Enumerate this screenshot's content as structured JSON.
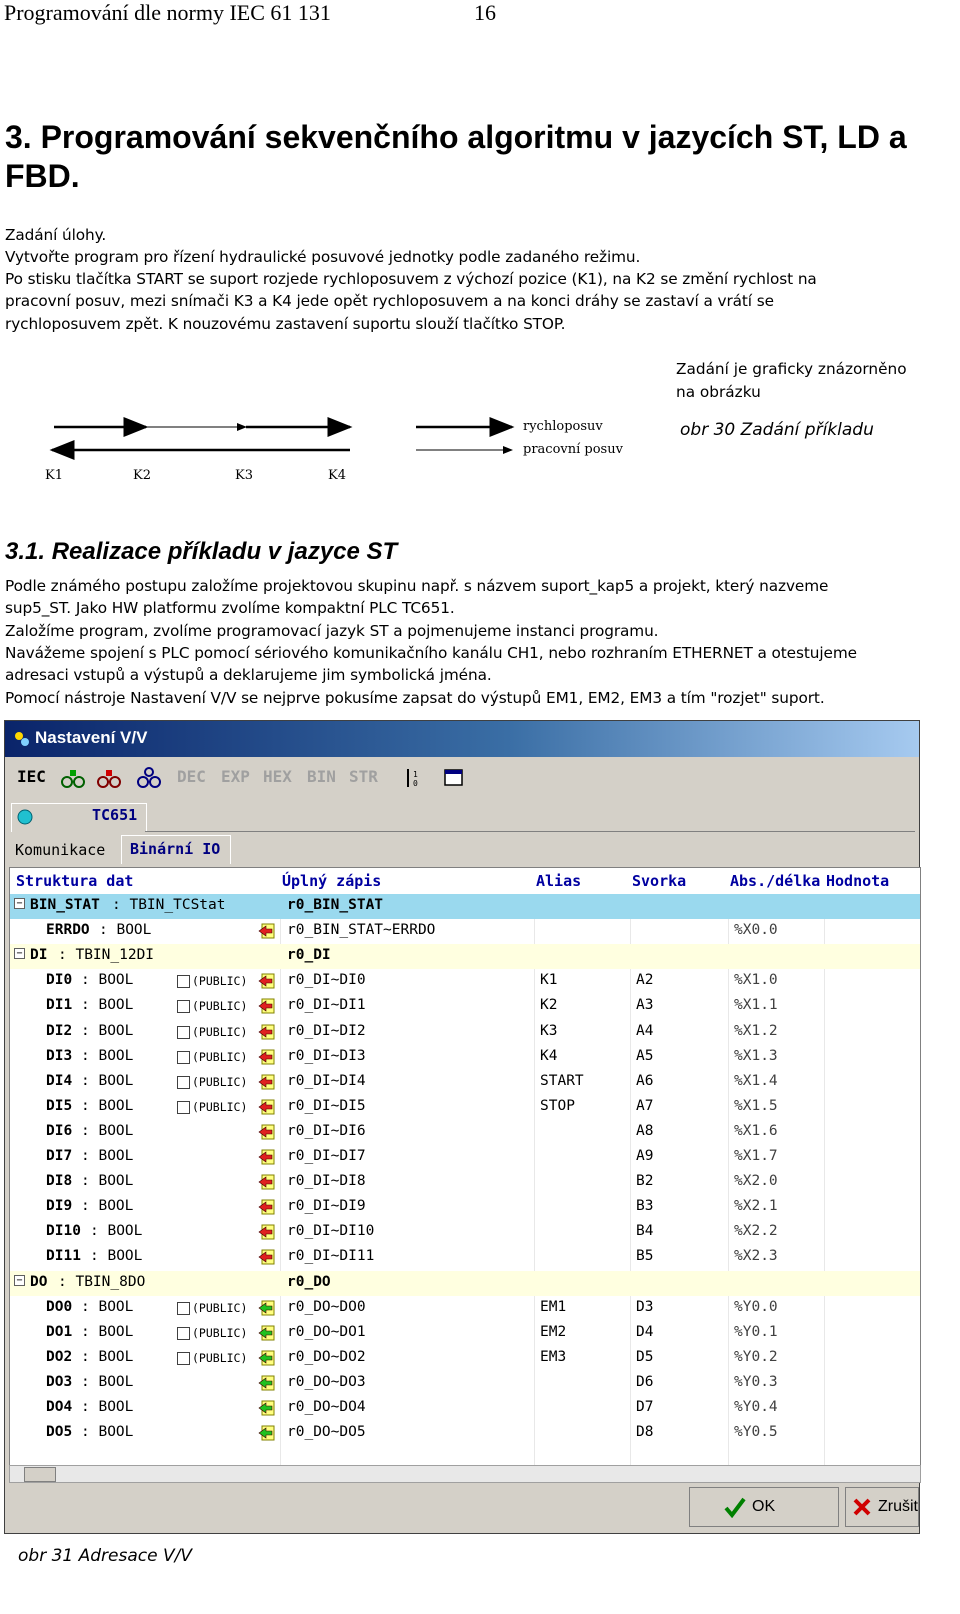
{
  "header": {
    "title": "Programování dle normy IEC 61 131",
    "page": "16"
  },
  "chapter_title": "3. Programování sekvenčního algoritmu v jazycích ST, LD a FBD.",
  "task": {
    "heading": "Zadání úlohy.",
    "lines": [
      "Vytvořte program pro řízení hydraulické posuvové jednotky podle zadaného režimu.",
      "Po stisku tlačítka START se suport rozjede rychloposuvem z výchozí pozice (K1), na K2 se změní rychlost na",
      "pracovní posuv, mezi snímači K3 a K4 jede opět rychloposuvem a na konci dráhy se zastaví a vrátí se",
      "rychloposuvem zpět. K nouzovému zastavení suportu slouží tlačítko STOP."
    ]
  },
  "figure30": {
    "note_lines": [
      "Zadání je graficky znázorněno",
      "na obrázku"
    ],
    "caption": "obr 30 Zadání příkladu",
    "positions": [
      "K1",
      "K2",
      "K3",
      "K4"
    ],
    "legend": [
      "rychloposuv",
      "pracovní posuv"
    ]
  },
  "section": "3.1. Realizace příkladu v jazyce ST",
  "paragraphs": [
    "Podle známého postupu založíme projektovou skupinu např. s názvem suport_kap5 a projekt, který nazveme",
    "sup5_ST. Jako HW platformu zvolíme kompaktní PLC TC651.",
    "Založíme program, zvolíme programovací jazyk ST a pojmenujeme instanci programu.",
    "Navážeme spojení s PLC pomocí sériového komunikačního kanálu CH1, nebo rozhraním ETHERNET a otestujeme",
    "adresaci vstupů a výstupů a deklarujeme jim symbolická jména.",
    "Pomocí nástroje Nastavení V/V se nejprve pokusíme zapsat do výstupů EM1, EM2, EM3 a tím \"rozjet\" suport."
  ],
  "window": {
    "title": "Nastavení V/V",
    "toolbar": [
      "IEC",
      "DEC",
      "EXP",
      "HEX",
      "BIN",
      "STR"
    ],
    "plc_tab": "TC651",
    "tabs": [
      "Komunikace",
      "Binární IO"
    ],
    "columns": [
      "Struktura dat",
      "Úplný zápis",
      "Alias",
      "Svorka",
      "Abs./délka",
      "Hodnota"
    ],
    "rows": [
      {
        "name": "BIN_STAT",
        "type": ": TBIN_TCStat",
        "full": "r0_BIN_STAT",
        "kind": "group-sel"
      },
      {
        "name": "ERRDO",
        "type": ": BOOL",
        "full": "r0_BIN_STAT~ERRDO",
        "addr": "%X0.0",
        "dir": "in"
      },
      {
        "name": "DI",
        "type": ": TBIN_12DI",
        "full": "r0_DI",
        "kind": "group"
      },
      {
        "name": "DI0",
        "type": ": BOOL",
        "pub": "(PUBLIC)",
        "full": "r0_DI~DI0",
        "alias": "K1",
        "term": "A2",
        "addr": "%X1.0",
        "dir": "in"
      },
      {
        "name": "DI1",
        "type": ": BOOL",
        "pub": "(PUBLIC)",
        "full": "r0_DI~DI1",
        "alias": "K2",
        "term": "A3",
        "addr": "%X1.1",
        "dir": "in"
      },
      {
        "name": "DI2",
        "type": ": BOOL",
        "pub": "(PUBLIC)",
        "full": "r0_DI~DI2",
        "alias": "K3",
        "term": "A4",
        "addr": "%X1.2",
        "dir": "in"
      },
      {
        "name": "DI3",
        "type": ": BOOL",
        "pub": "(PUBLIC)",
        "full": "r0_DI~DI3",
        "alias": "K4",
        "term": "A5",
        "addr": "%X1.3",
        "dir": "in"
      },
      {
        "name": "DI4",
        "type": ": BOOL",
        "pub": "(PUBLIC)",
        "full": "r0_DI~DI4",
        "alias": "START",
        "term": "A6",
        "addr": "%X1.4",
        "dir": "in"
      },
      {
        "name": "DI5",
        "type": ": BOOL",
        "pub": "(PUBLIC)",
        "full": "r0_DI~DI5",
        "alias": "STOP",
        "term": "A7",
        "addr": "%X1.5",
        "dir": "in"
      },
      {
        "name": "DI6",
        "type": ": BOOL",
        "full": "r0_DI~DI6",
        "term": "A8",
        "addr": "%X1.6",
        "dir": "in"
      },
      {
        "name": "DI7",
        "type": ": BOOL",
        "full": "r0_DI~DI7",
        "term": "A9",
        "addr": "%X1.7",
        "dir": "in"
      },
      {
        "name": "DI8",
        "type": ": BOOL",
        "full": "r0_DI~DI8",
        "term": "B2",
        "addr": "%X2.0",
        "dir": "in"
      },
      {
        "name": "DI9",
        "type": ": BOOL",
        "full": "r0_DI~DI9",
        "term": "B3",
        "addr": "%X2.1",
        "dir": "in"
      },
      {
        "name": "DI10",
        "type": ": BOOL",
        "full": "r0_DI~DI10",
        "term": "B4",
        "addr": "%X2.2",
        "dir": "in"
      },
      {
        "name": "DI11",
        "type": ": BOOL",
        "full": "r0_DI~DI11",
        "term": "B5",
        "addr": "%X2.3",
        "dir": "in"
      },
      {
        "name": "DO",
        "type": ": TBIN_8DO",
        "full": "r0_DO",
        "kind": "group"
      },
      {
        "name": "DO0",
        "type": ": BOOL",
        "pub": "(PUBLIC)",
        "full": "r0_DO~DO0",
        "alias": "EM1",
        "term": "D3",
        "addr": "%Y0.0",
        "dir": "out"
      },
      {
        "name": "DO1",
        "type": ": BOOL",
        "pub": "(PUBLIC)",
        "full": "r0_DO~DO1",
        "alias": "EM2",
        "term": "D4",
        "addr": "%Y0.1",
        "dir": "out"
      },
      {
        "name": "DO2",
        "type": ": BOOL",
        "pub": "(PUBLIC)",
        "full": "r0_DO~DO2",
        "alias": "EM3",
        "term": "D5",
        "addr": "%Y0.2",
        "dir": "out"
      },
      {
        "name": "DO3",
        "type": ": BOOL",
        "full": "r0_DO~DO3",
        "term": "D6",
        "addr": "%Y0.3",
        "dir": "out"
      },
      {
        "name": "DO4",
        "type": ": BOOL",
        "full": "r0_DO~DO4",
        "term": "D7",
        "addr": "%Y0.4",
        "dir": "out"
      },
      {
        "name": "DO5",
        "type": ": BOOL",
        "full": "r0_DO~DO5",
        "term": "D8",
        "addr": "%Y0.5",
        "dir": "out"
      }
    ],
    "ok_label": "OK",
    "cancel_label": "Zrušit"
  },
  "figure31_caption": "obr 31 Adresace V/V"
}
